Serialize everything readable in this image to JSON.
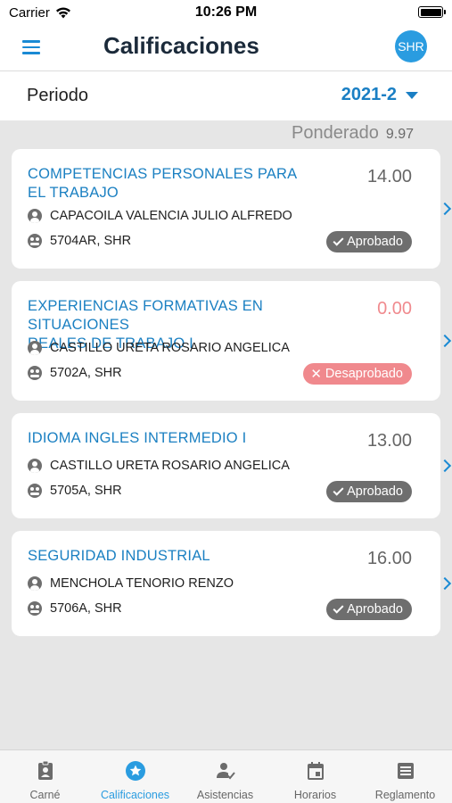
{
  "status": {
    "carrier": "Carrier",
    "time": "10:26 PM"
  },
  "header": {
    "title": "Calificaciones",
    "avatar_initials": "SHR"
  },
  "period": {
    "label": "Periodo",
    "value": "2021-2"
  },
  "weighted": {
    "label": "Ponderado",
    "value": "9.97"
  },
  "courses": [
    {
      "name_line1": "COMPETENCIAS PERSONALES PARA",
      "name_line2": "EL TRABAJO",
      "grade": "14.00",
      "teacher": "CAPACOILA VALENCIA JULIO ALFREDO",
      "section": "5704AR, SHR",
      "status": "Aprobado"
    },
    {
      "name_line1": "EXPERIENCIAS FORMATIVAS EN SITUACIONES",
      "name_line2": "REALES DE TRABAJO I",
      "grade": "0.00",
      "teacher": "CASTILLO URETA ROSARIO ANGELICA",
      "section": "5702A, SHR",
      "status": "Desaprobado"
    },
    {
      "name_line1": "IDIOMA INGLES INTERMEDIO I",
      "grade": "13.00",
      "teacher": "CASTILLO URETA ROSARIO ANGELICA",
      "section": "5705A, SHR",
      "status": "Aprobado"
    },
    {
      "name_line1": "SEGURIDAD INDUSTRIAL",
      "grade": "16.00",
      "teacher": "MENCHOLA TENORIO RENZO",
      "section": "5706A, SHR",
      "status": "Aprobado"
    }
  ],
  "tabs": [
    {
      "label": "Carné",
      "icon": "id-badge-icon"
    },
    {
      "label": "Calificaciones",
      "icon": "star-icon",
      "active": true
    },
    {
      "label": "Asistencias",
      "icon": "user-check-icon"
    },
    {
      "label": "Horarios",
      "icon": "calendar-icon"
    },
    {
      "label": "Reglamento",
      "icon": "document-icon"
    }
  ],
  "colors": {
    "accent": "#2a9ce0",
    "link": "#1b80c2",
    "fail": "#f08a8e",
    "pass_badge": "#6e6e6e"
  }
}
